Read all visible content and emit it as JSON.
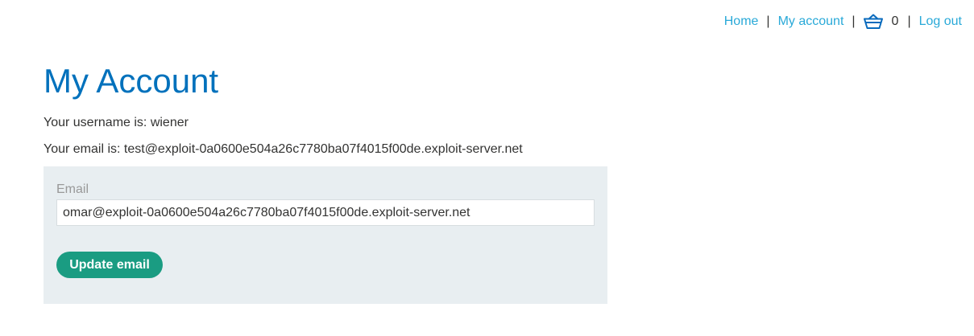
{
  "nav": {
    "home": "Home",
    "my_account": "My account",
    "separator": "|",
    "cart_count": "0",
    "cart_icon": "basket-icon",
    "log_out": "Log out"
  },
  "page": {
    "title": "My Account",
    "username_line": "Your username is: wiener",
    "email_line": "Your email is: test@exploit-0a0600e504a26c7780ba07f4015f00de.exploit-server.net"
  },
  "form": {
    "email_label": "Email",
    "email_value": "omar@exploit-0a0600e504a26c7780ba07f4015f00de.exploit-server.net",
    "submit_label": "Update email"
  },
  "colors": {
    "link": "#29a9d8",
    "title": "#0071bc",
    "panel_bg": "#e8eef1",
    "button_bg": "#1a9c82"
  }
}
